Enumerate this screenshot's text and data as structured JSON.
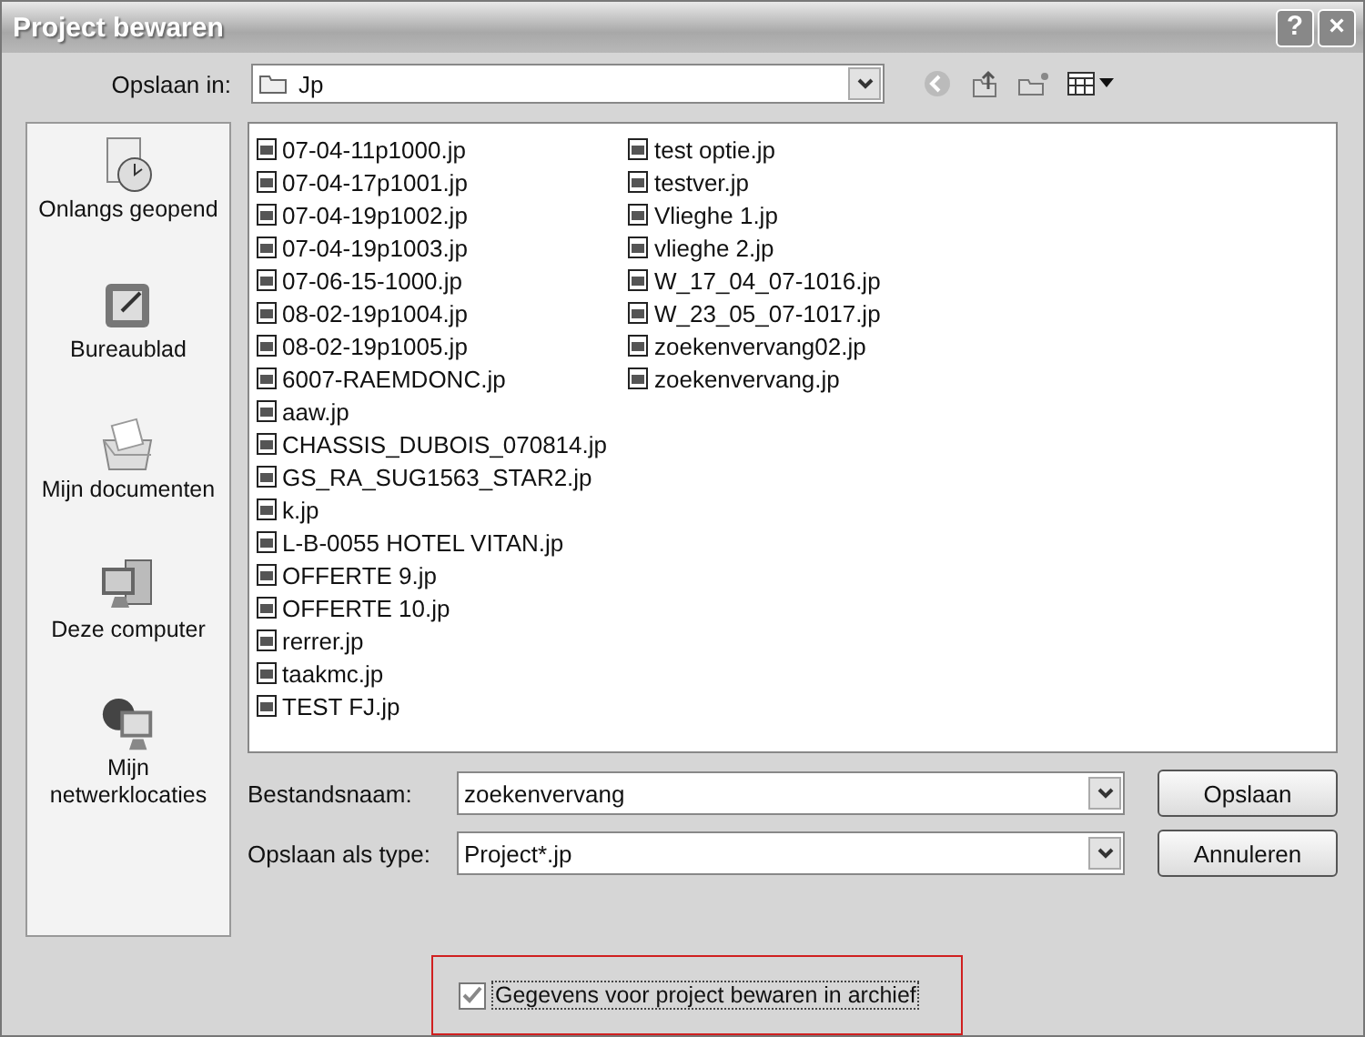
{
  "window": {
    "title": "Project bewaren",
    "help": "?",
    "close": "×"
  },
  "save_in": {
    "label": "Opslaan in:",
    "value": "Jp"
  },
  "places": [
    {
      "label": "Onlangs geopend",
      "kind": "recent"
    },
    {
      "label": "Bureaublad",
      "kind": "desktop"
    },
    {
      "label": "Mijn documenten",
      "kind": "documents"
    },
    {
      "label": "Deze computer",
      "kind": "computer"
    },
    {
      "label": "Mijn netwerklocaties",
      "kind": "network"
    }
  ],
  "files": [
    "07-04-11p1000.jp",
    "07-04-17p1001.jp",
    "07-04-19p1002.jp",
    "07-04-19p1003.jp",
    "07-06-15-1000.jp",
    "08-02-19p1004.jp",
    "08-02-19p1005.jp",
    "6007-RAEMDONC.jp",
    "aaw.jp",
    "CHASSIS_DUBOIS_070814.jp",
    "GS_RA_SUG1563_STAR2.jp",
    "k.jp",
    "L-B-0055 HOTEL VITAN.jp",
    "OFFERTE 9.jp",
    "OFFERTE 10.jp",
    "rerrer.jp",
    "taakmc.jp",
    "TEST FJ.jp",
    "test optie.jp",
    "testver.jp",
    "Vlieghe 1.jp",
    "vlieghe 2.jp",
    "W_17_04_07-1016.jp",
    "W_23_05_07-1017.jp",
    "zoekenvervang02.jp",
    "zoekenvervang.jp"
  ],
  "filename": {
    "label": "Bestandsnaam:",
    "value": "zoekenvervang"
  },
  "filetype": {
    "label": "Opslaan als type:",
    "value": "Project*.jp"
  },
  "buttons": [
    "Opslaan",
    "Annuleren"
  ],
  "archive": {
    "label": "Gegevens voor project bewaren in archief",
    "checked": true
  }
}
